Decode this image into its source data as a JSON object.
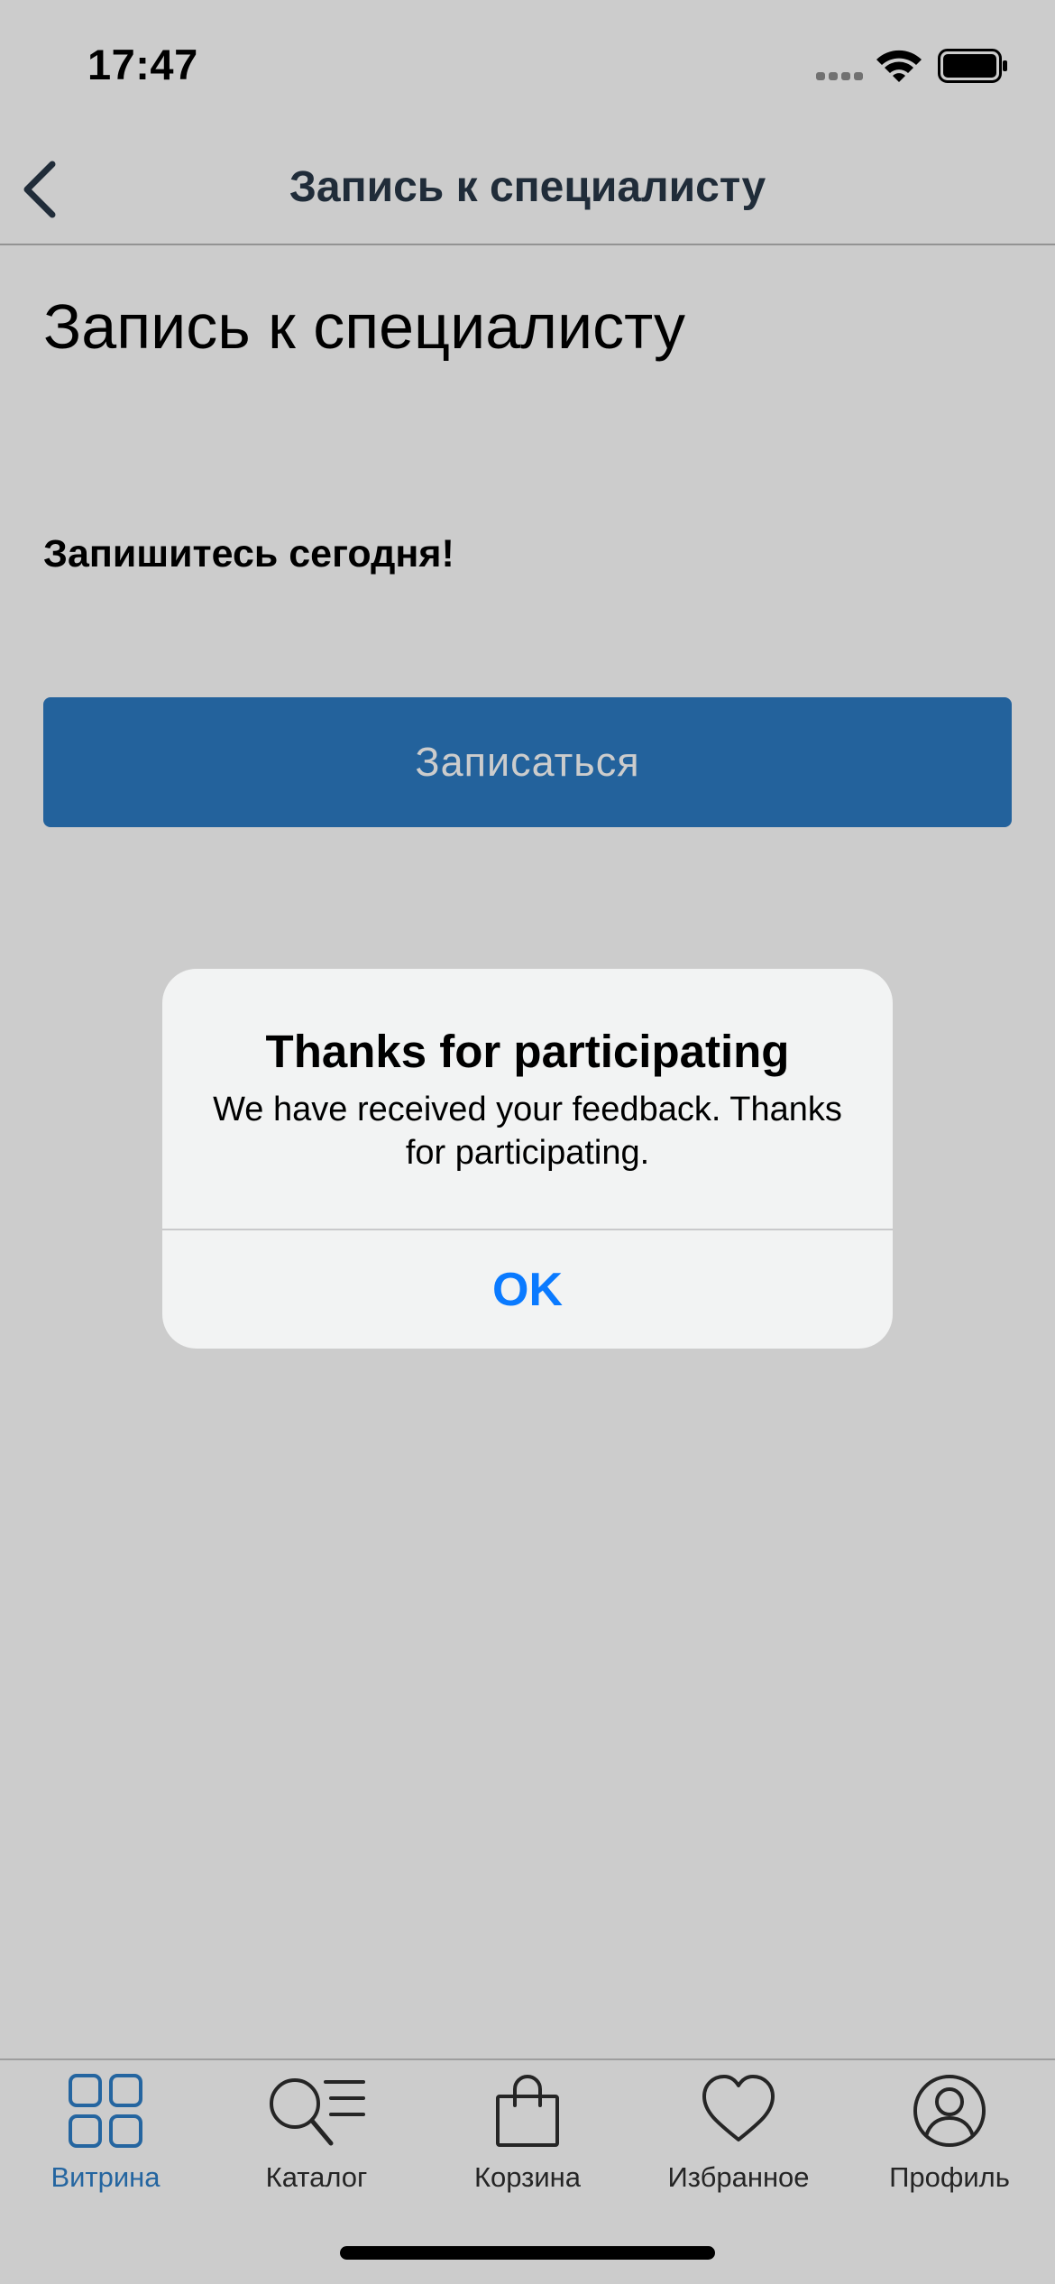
{
  "status_bar": {
    "time": "17:47"
  },
  "nav": {
    "back_icon": "chevron-left-icon",
    "title": "Запись к специалисту"
  },
  "content": {
    "page_title": "Запись к специалисту",
    "subtitle": "Запишитесь сегодня!",
    "button_label": "Записаться"
  },
  "tabs": [
    {
      "icon": "grid-icon",
      "label": "Витрина",
      "active": true
    },
    {
      "icon": "search-list-icon",
      "label": "Каталог",
      "active": false
    },
    {
      "icon": "bag-icon",
      "label": "Корзина",
      "active": false
    },
    {
      "icon": "heart-icon",
      "label": "Избранное",
      "active": false
    },
    {
      "icon": "profile-icon",
      "label": "Профиль",
      "active": false
    }
  ],
  "alert": {
    "title": "Thanks for participating",
    "message": "We have received your feedback. Thanks for participating.",
    "ok_label": "OK"
  },
  "colors": {
    "accent": "#2c7bc4",
    "tab_active": "#2d7fc8",
    "alert_button": "#0a7aff",
    "nav_title": "#283848"
  }
}
